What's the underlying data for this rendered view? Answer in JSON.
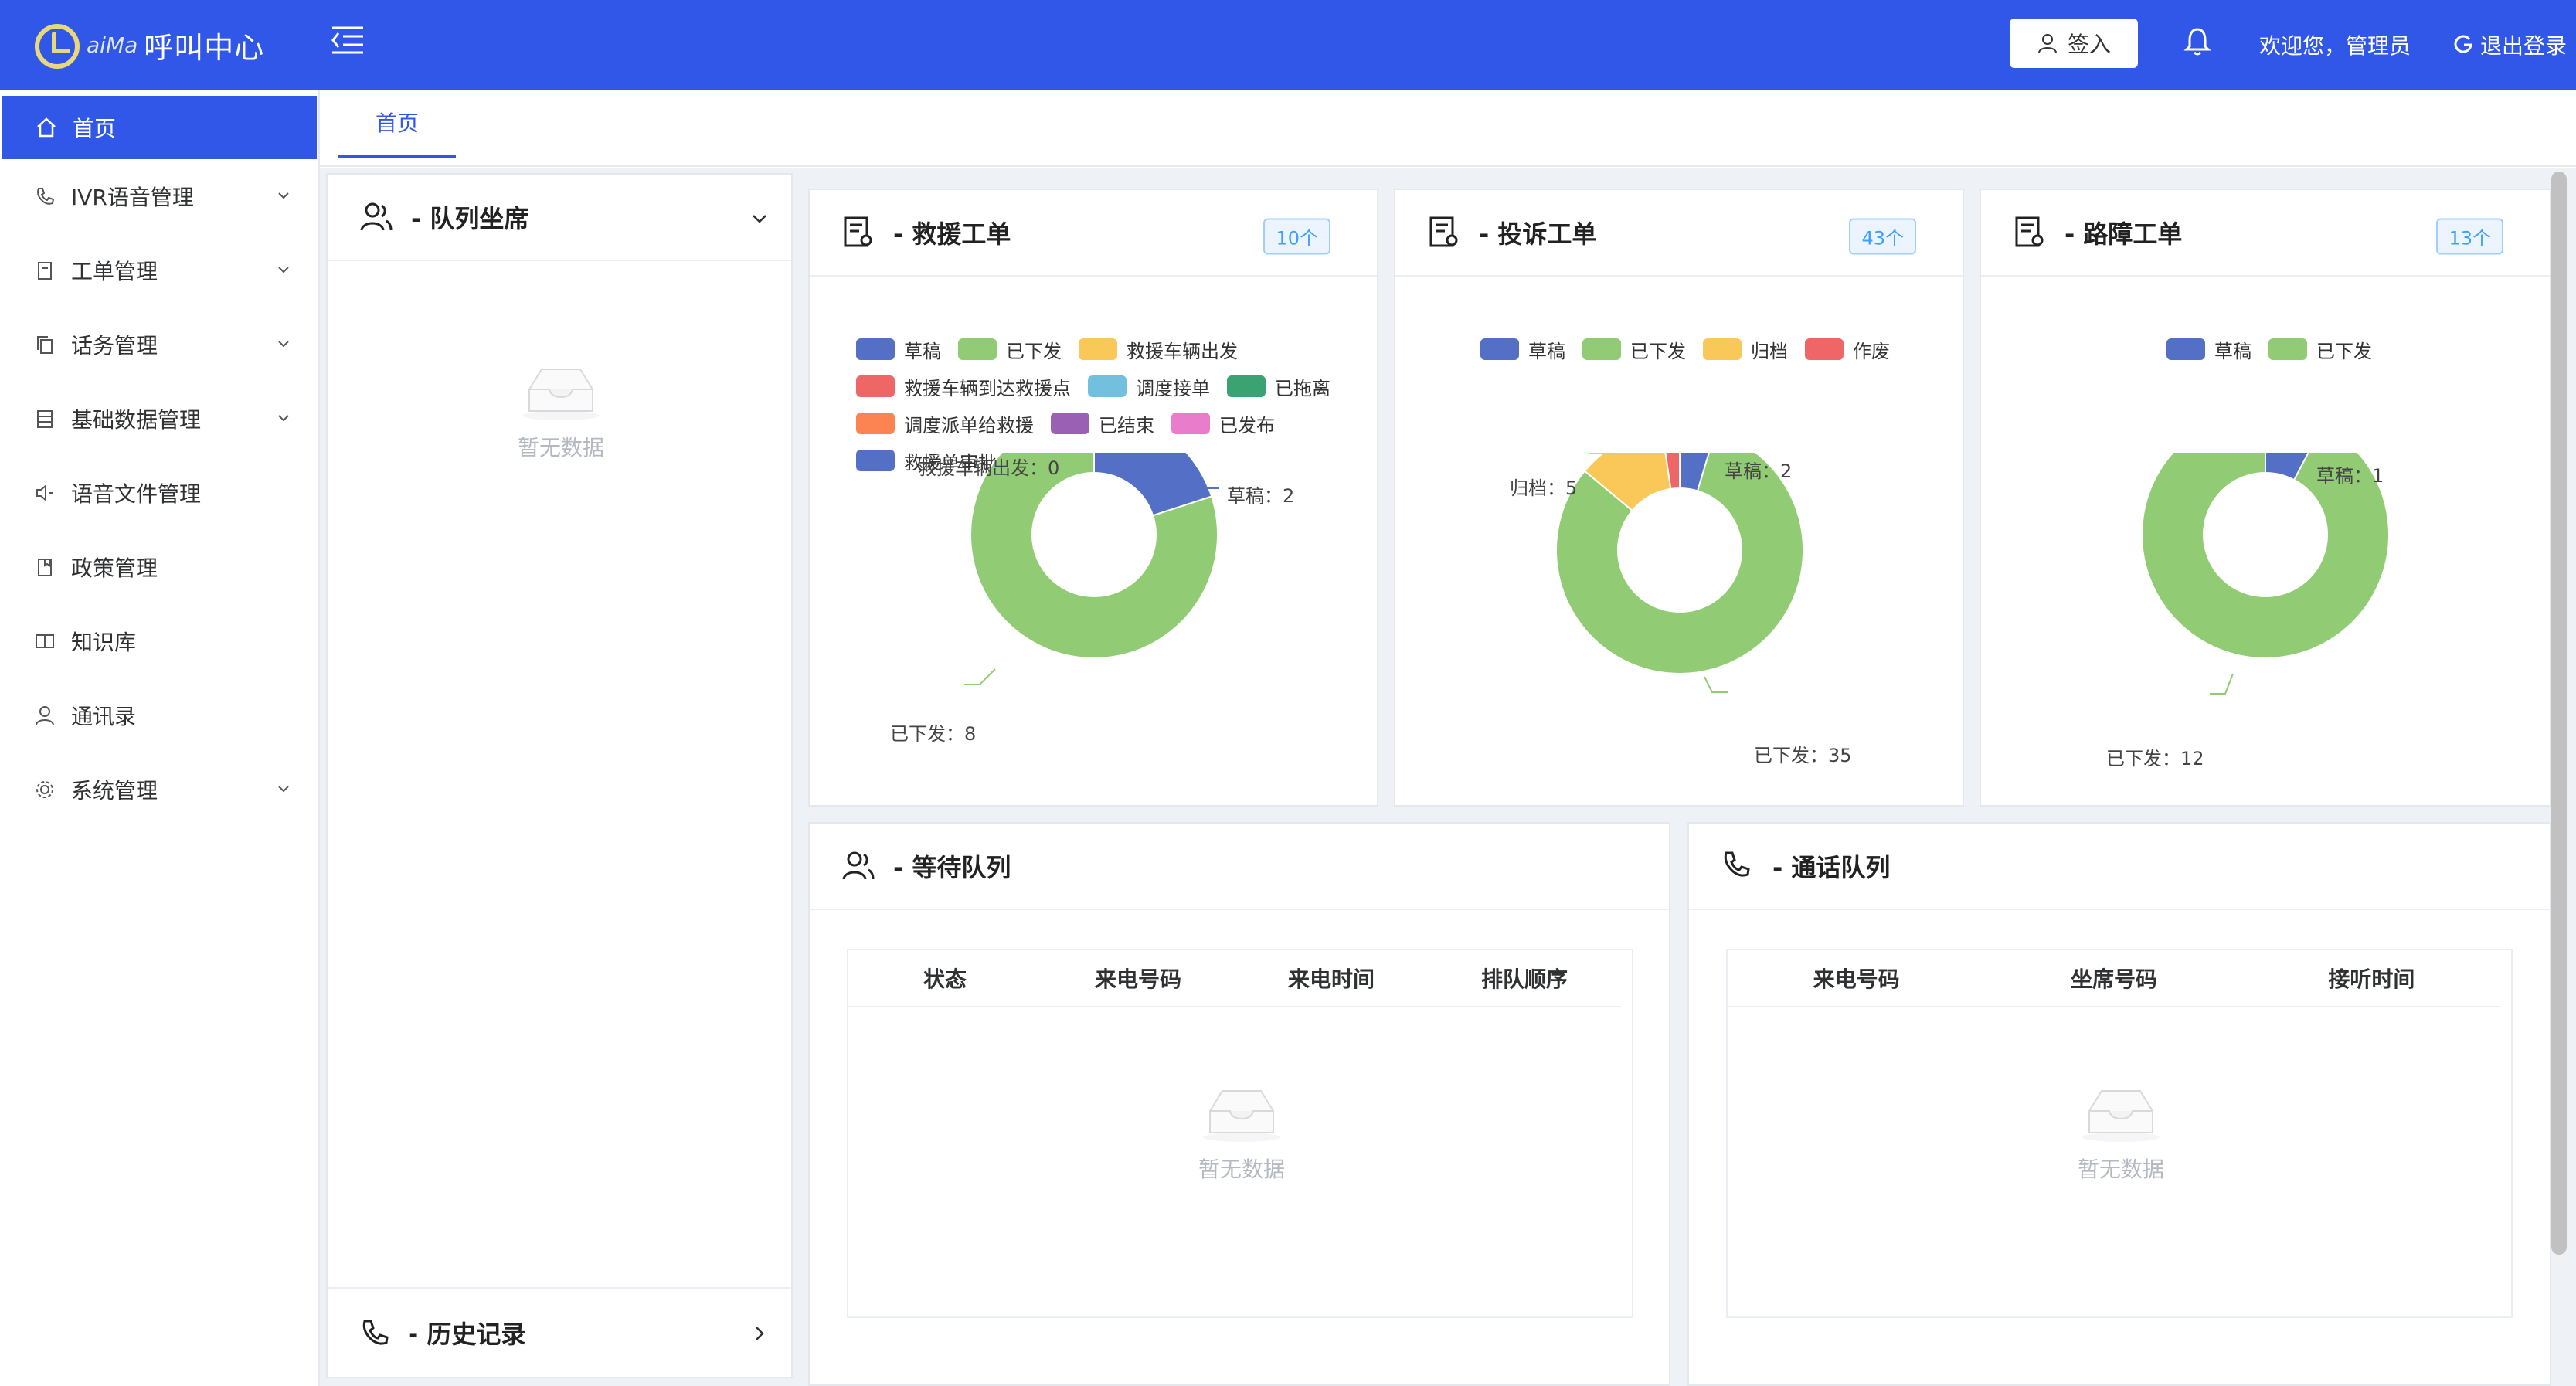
{
  "header": {
    "brand_small": "aiMa",
    "brand_name": "呼叫中心",
    "signin_label": "签入",
    "welcome": "欢迎您，管理员",
    "logout_label": "退出登录",
    "accent": "#3057e8"
  },
  "sidebar": {
    "items": [
      {
        "label": "首页",
        "icon": "home-icon",
        "active": true
      },
      {
        "label": "IVR语音管理",
        "icon": "phone-icon",
        "expandable": true
      },
      {
        "label": "工单管理",
        "icon": "document-icon",
        "expandable": true
      },
      {
        "label": "话务管理",
        "icon": "copy-icon",
        "expandable": true
      },
      {
        "label": "基础数据管理",
        "icon": "list-icon",
        "expandable": true
      },
      {
        "label": "语音文件管理",
        "icon": "speaker-icon"
      },
      {
        "label": "政策管理",
        "icon": "book-icon"
      },
      {
        "label": "知识库",
        "icon": "reader-icon"
      },
      {
        "label": "通讯录",
        "icon": "user-icon"
      },
      {
        "label": "系统管理",
        "icon": "gear-icon",
        "expandable": true
      }
    ]
  },
  "tabs": [
    {
      "label": "首页"
    }
  ],
  "queue_panel": {
    "title": "- 队列坐席",
    "empty_text": "暂无数据",
    "history_title": "- 历史记录"
  },
  "cards": [
    {
      "title": "- 救援工单",
      "count": "10个"
    },
    {
      "title": "- 投诉工单",
      "count": "43个"
    },
    {
      "title": "- 路障工单",
      "count": "13个"
    }
  ],
  "chart_data": [
    {
      "type": "pie",
      "legend": [
        {
          "name": "草稿",
          "color": "#5470c6"
        },
        {
          "name": "已下发",
          "color": "#91cc75"
        },
        {
          "name": "救援车辆出发",
          "color": "#fac858"
        },
        {
          "name": "救援车辆到达救援点",
          "color": "#ee6666"
        },
        {
          "name": "调度接单",
          "color": "#73c0de"
        },
        {
          "name": "已拖离",
          "color": "#3ba272"
        },
        {
          "name": "调度派单给救援",
          "color": "#fc8452"
        },
        {
          "name": "已结束",
          "color": "#9a60b4"
        },
        {
          "name": "已发布",
          "color": "#ea7ccc"
        },
        {
          "name": "救援单审批车辆",
          "color": "#5470c6"
        }
      ],
      "slices": [
        {
          "name": "草稿",
          "value": 2,
          "color": "#5470c6"
        },
        {
          "name": "已下发",
          "value": 8,
          "color": "#91cc75"
        }
      ],
      "labels": [
        "草稿：2",
        "已下发：8",
        "救援车辆出发：0"
      ]
    },
    {
      "type": "pie",
      "legend": [
        {
          "name": "草稿",
          "color": "#5470c6"
        },
        {
          "name": "已下发",
          "color": "#91cc75"
        },
        {
          "name": "归档",
          "color": "#fac858"
        },
        {
          "name": "作废",
          "color": "#ee6666"
        }
      ],
      "slices": [
        {
          "name": "草稿",
          "value": 2,
          "color": "#5470c6"
        },
        {
          "name": "已下发",
          "value": 35,
          "color": "#91cc75"
        },
        {
          "name": "归档",
          "value": 5,
          "color": "#fac858"
        },
        {
          "name": "作废",
          "value": 1,
          "color": "#ee6666"
        }
      ],
      "labels": [
        "草稿：2",
        "已下发：35",
        "归档：5"
      ]
    },
    {
      "type": "pie",
      "legend": [
        {
          "name": "草稿",
          "color": "#5470c6"
        },
        {
          "name": "已下发",
          "color": "#91cc75"
        }
      ],
      "slices": [
        {
          "name": "草稿",
          "value": 1,
          "color": "#5470c6"
        },
        {
          "name": "已下发",
          "value": 12,
          "color": "#91cc75"
        }
      ],
      "labels": [
        "草稿：1",
        "已下发：12"
      ]
    }
  ],
  "wait_queue": {
    "title": "- 等待队列",
    "columns": [
      "状态",
      "来电号码",
      "来电时间",
      "排队顺序"
    ],
    "empty_text": "暂无数据"
  },
  "call_queue": {
    "title": "- 通话队列",
    "columns": [
      "来电号码",
      "坐席号码",
      "接听时间"
    ],
    "empty_text": "暂无数据"
  }
}
